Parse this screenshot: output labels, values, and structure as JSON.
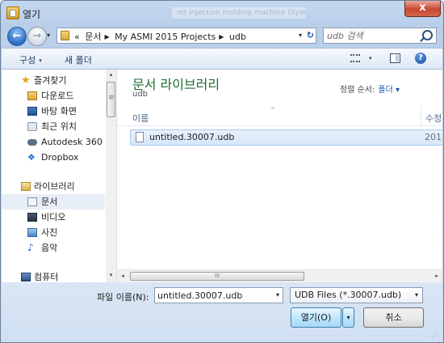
{
  "window": {
    "title": "열기",
    "background_title": "mt injection molding machine (System)",
    "close_label": "x"
  },
  "nav": {
    "back_label": "←",
    "forward_label": "→",
    "history_caret": "▾",
    "breadcrumb_lead": "«",
    "breadcrumb": [
      "문서",
      "My ASMI 2015 Projects",
      "udb"
    ],
    "address_dropdown": "▾",
    "refresh_label": "↻",
    "search_placeholder": "udb 검색"
  },
  "toolbar": {
    "organize_label": "구성",
    "organize_caret": "▾",
    "new_folder_label": "새 폴더",
    "view_caret": "▾",
    "help_label": "?"
  },
  "sidebar": {
    "items": [
      {
        "label": "즐겨찾기",
        "icon": "star-icon",
        "indent": 0
      },
      {
        "label": "다운로드",
        "icon": "download-folder-icon",
        "indent": 1
      },
      {
        "label": "바탕 화면",
        "icon": "desktop-icon",
        "indent": 1
      },
      {
        "label": "최근 위치",
        "icon": "recent-places-icon",
        "indent": 1
      },
      {
        "label": "Autodesk 360",
        "icon": "autodesk-360-icon",
        "indent": 1
      },
      {
        "label": "Dropbox",
        "icon": "dropbox-icon",
        "indent": 1
      },
      {
        "label": "라이브러리",
        "icon": "libraries-icon",
        "indent": 0
      },
      {
        "label": "문서",
        "icon": "documents-icon",
        "indent": 1,
        "selected": true
      },
      {
        "label": "비디오",
        "icon": "videos-icon",
        "indent": 1
      },
      {
        "label": "사진",
        "icon": "pictures-icon",
        "indent": 1
      },
      {
        "label": "음악",
        "icon": "music-icon",
        "indent": 1
      },
      {
        "label": "컴퓨터",
        "icon": "computer-icon",
        "indent": 0
      }
    ],
    "scroll_up": "▴",
    "scroll_down": "▾"
  },
  "library": {
    "title": "문서 라이브러리",
    "subtitle": "udb",
    "arrange_label": "정렬 순서:",
    "arrange_value": "폴더",
    "arrange_caret": "▾"
  },
  "list": {
    "columns": [
      "이름",
      "수정"
    ],
    "sort_indicator": "^",
    "files": [
      {
        "name": "untitled.30007.udb",
        "date": "201"
      }
    ],
    "hscroll_left": "◂",
    "hscroll_right": "▸",
    "hscroll_grip": "III"
  },
  "footer": {
    "filename_label": "파일 이름(N):",
    "filename_value": "untitled.30007.udb",
    "filename_dropdown": "▾",
    "filetype_value": "UDB Files (*.30007.udb)",
    "filetype_dropdown": "▾",
    "open_label": "열기(O)",
    "open_dropdown": "▾",
    "cancel_label": "취소",
    "grip": "⋰"
  },
  "colors": {
    "accent": "#1c5aa8",
    "library_title": "#1e6b2f",
    "selection": "#d5e6fa",
    "close_button": "#c9472f"
  }
}
